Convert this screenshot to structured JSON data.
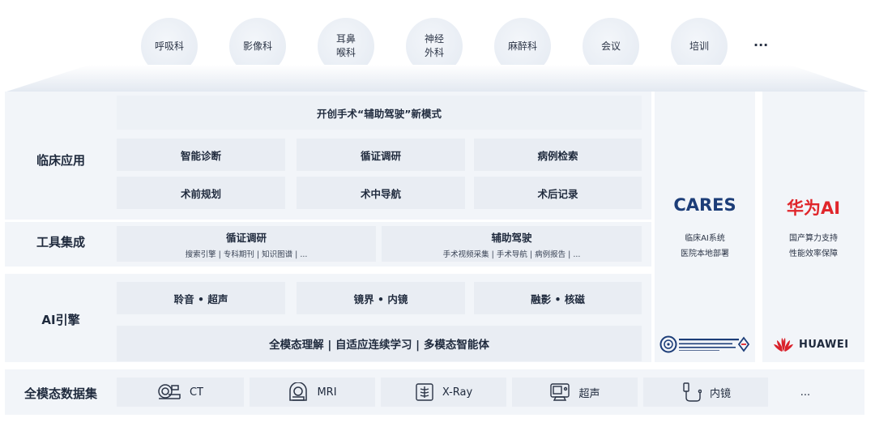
{
  "departments": [
    {
      "label": "呼吸科"
    },
    {
      "label": "影像科"
    },
    {
      "label": "耳鼻\n喉科"
    },
    {
      "label": "神经\n外科"
    },
    {
      "label": "麻醉科"
    },
    {
      "label": "会议"
    },
    {
      "label": "培训"
    }
  ],
  "departments_more": "···",
  "clinical": {
    "label": "临床应用",
    "banner": "开创手术“辅助驾驶”新模式",
    "items": [
      "智能诊断",
      "循证调研",
      "病例检索",
      "术前规划",
      "术中导航",
      "术后记录"
    ]
  },
  "tools": {
    "label": "工具集成",
    "items": [
      {
        "title": "循证调研",
        "sub": "搜索引擎 | 专科期刊 | 知识图谱 | ..."
      },
      {
        "title": "辅助驾驶",
        "sub": "手术视频采集 | 手术导航 | 病例报告 | ..."
      }
    ]
  },
  "ai_engine": {
    "label": "AI引擎",
    "items": [
      "聆音 • 超声",
      "镜界 • 内镜",
      "融影 • 核磁"
    ],
    "banner": "全模态理解 | 自适应连续学习 | 多模态智能体"
  },
  "dataset": {
    "label": "全模态数据集",
    "items": [
      {
        "label": "CT",
        "icon": "ct-scanner-icon"
      },
      {
        "label": "MRI",
        "icon": "mri-icon"
      },
      {
        "label": "X-Ray",
        "icon": "xray-icon"
      },
      {
        "label": "超声",
        "icon": "ultrasound-icon"
      },
      {
        "label": "内镜",
        "icon": "endoscope-icon"
      },
      {
        "label": "...",
        "icon": ""
      }
    ]
  },
  "cares": {
    "brand": "CARES",
    "brand_color": "#1c3d78",
    "lines": [
      "临床AI系统",
      "医院本地部署"
    ]
  },
  "huawei": {
    "brand": "华为AI",
    "brand_color": "#e0262b",
    "lines": [
      "国产算力支持",
      "性能效率保障"
    ],
    "logo_text": "HUAWEI"
  },
  "colors": {
    "huawei_red": "#d9202a",
    "cas_blue": "#1c3d78"
  }
}
